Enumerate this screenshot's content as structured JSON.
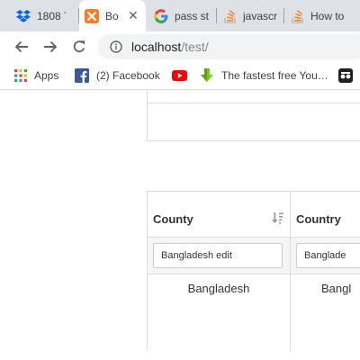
{
  "browser": {
    "tabs": [
      {
        "title": "1808 T",
        "icon": "dropbox-icon",
        "active": false
      },
      {
        "title": "Bo",
        "icon": "xampp-icon",
        "active": true
      },
      {
        "title": "pass st",
        "icon": "google-icon",
        "active": false
      },
      {
        "title": "javascr",
        "icon": "stackoverflow-icon",
        "active": false
      },
      {
        "title": "How to",
        "icon": "stackoverflow-icon",
        "active": false
      }
    ],
    "url_host": "localhost",
    "url_path": "/test/",
    "bookmarks": [
      {
        "label": "Apps",
        "icon": "apps-grid-icon"
      },
      {
        "label": "(2) Facebook",
        "icon": "facebook-icon"
      },
      {
        "label": "",
        "icon": "youtube-icon"
      },
      {
        "label": "The fastest free You…",
        "icon": "download-arrow-icon"
      },
      {
        "label": "",
        "icon": "extension-icon"
      }
    ]
  },
  "grid": {
    "columns": [
      {
        "header": "County",
        "filter_value": "Bangladesh edit",
        "cell": "Bangladesh",
        "sortable": true
      },
      {
        "header": "Country",
        "filter_value": "Banglade",
        "cell": "Bangl",
        "sortable": false
      }
    ]
  },
  "colors": {
    "tabstrip": "#dee1e6",
    "omnibox": "#f1f3f4",
    "grid_border": "#dddddd",
    "filter_row": "#f5f5f5"
  }
}
